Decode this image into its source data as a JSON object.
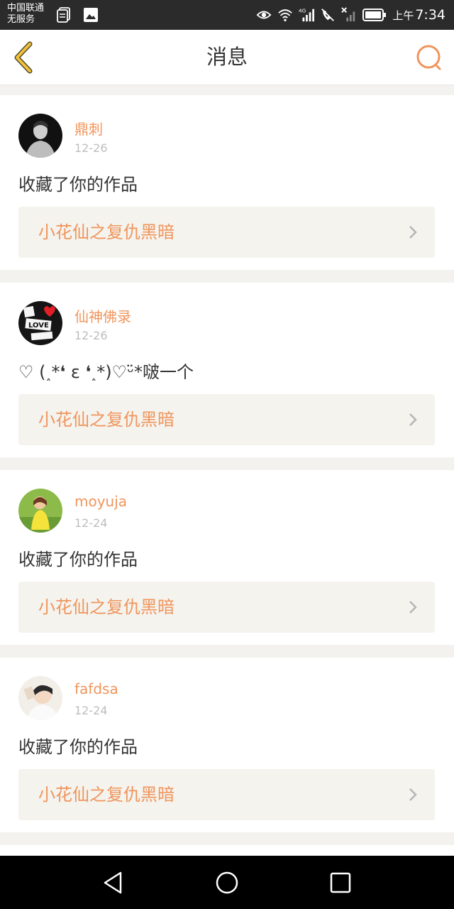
{
  "status_bar": {
    "carrier_line1": "中国联通",
    "carrier_line2": "无服务",
    "network": "4G",
    "ampm": "上午",
    "time": "7:34"
  },
  "header": {
    "title": "消息",
    "accent_color": "#f0955c"
  },
  "messages": [
    {
      "user": "鼎刺",
      "date": "12-26",
      "text": "收藏了你的作品",
      "work": "小花仙之复仇黑暗",
      "avatar": "avatar-man-dark"
    },
    {
      "user": "仙神佛录",
      "date": "12-26",
      "text": "♡ (˰*❛ ε ❛˰*)♡ᵕ̈*啵一个",
      "work": "小花仙之复仇黑暗",
      "avatar": "avatar-love-heart"
    },
    {
      "user": "moyuja",
      "date": "12-24",
      "text": "收藏了你的作品",
      "work": "小花仙之复仇黑暗",
      "avatar": "avatar-girl-yellow"
    },
    {
      "user": "fafdsa",
      "date": "12-24",
      "text": "收藏了你的作品",
      "work": "小花仙之复仇黑暗",
      "avatar": "avatar-boy-light"
    }
  ]
}
